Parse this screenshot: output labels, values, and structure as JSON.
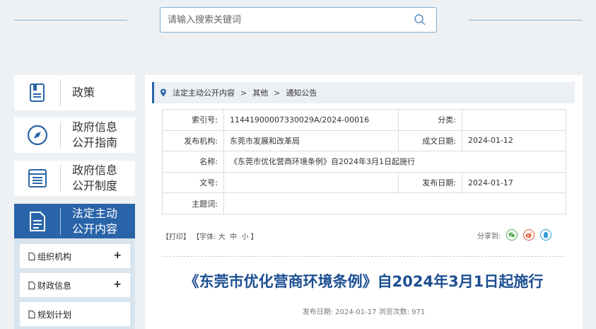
{
  "search": {
    "placeholder": "请输入搜索关键词"
  },
  "sidebar": {
    "items": [
      {
        "label": "政策",
        "icon": "book-icon"
      },
      {
        "label_line1": "政府信息",
        "label_line2": "公开指南",
        "icon": "compass-icon"
      },
      {
        "label_line1": "政府信息",
        "label_line2": "公开制度",
        "icon": "list-doc-icon"
      },
      {
        "label_line1": "法定主动",
        "label_line2": "公开内容",
        "icon": "document-icon",
        "active": true
      }
    ],
    "subitems": [
      {
        "label": "组织机构",
        "expandable": "+"
      },
      {
        "label": "财政信息",
        "expandable": "+"
      },
      {
        "label": "规划计划"
      }
    ]
  },
  "breadcrumb": {
    "items": [
      "法定主动公开内容",
      "其他",
      "通知公告"
    ],
    "separator": ">"
  },
  "meta": {
    "index_label": "索引号:",
    "index_value": "11441900007330029A/2024-00016",
    "category_label": "分类:",
    "category_value": "",
    "publisher_label": "发布机构:",
    "publisher_value": "东莞市发展和改革局",
    "created_label": "成文日期:",
    "created_value": "2024-01-12",
    "name_label": "名称:",
    "name_value": "《东莞市优化营商环境条例》自2024年3月1日起施行",
    "docno_label": "文号:",
    "docno_value": "",
    "pubdate_label": "发布日期:",
    "pubdate_value": "2024-01-17",
    "subject_label": "主题词:",
    "subject_value": ""
  },
  "tools": {
    "print": "【打印】",
    "font_prefix": "【字体:",
    "font_large": "大",
    "font_medium": "中",
    "font_small": "小",
    "font_suffix": "】",
    "share_label": "分享到:"
  },
  "article": {
    "title": "《东莞市优化营商环境条例》自2024年3月1日起施行",
    "pubinfo": "发布日期: 2024-01-17  浏览次数: 971"
  },
  "colors": {
    "accent": "#2a64a8",
    "title": "#1d4f92",
    "wechat": "#4caf50",
    "weibo": "#e2543b",
    "qq": "#2d9ad6"
  }
}
